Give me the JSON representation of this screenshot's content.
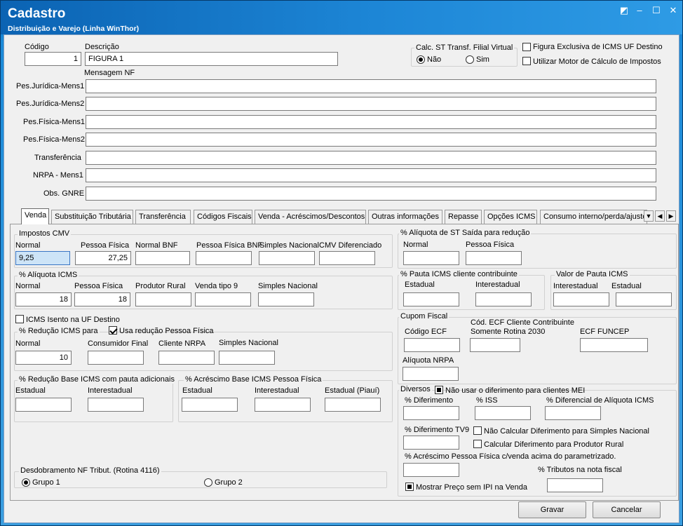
{
  "window": {
    "title": "Cadastro",
    "subtitle": "Distribuição e Varejo (Linha WinThor)",
    "btn_restore": "◩",
    "btn_min": "–",
    "btn_max": "☐",
    "btn_close": "✕"
  },
  "header": {
    "codigo_label": "Código",
    "codigo_value": "1",
    "descricao_label": "Descrição",
    "descricao_value": "FIGURA 1",
    "mensagem_nf_label": "Mensagem NF",
    "calc_st_label": "Calc. ST Transf. Filial Virtual",
    "radio_nao": "Não",
    "radio_sim": "Sim",
    "fig_exclusiva_label": "Figura Exclusiva de ICMS UF Destino",
    "motor_calc_label": "Utilizar Motor de Cálculo de Impostos"
  },
  "messages": [
    {
      "label": "Pes.Jurídica-Mens1"
    },
    {
      "label": "Pes.Jurídica-Mens2"
    },
    {
      "label": "Pes.Física-Mens1"
    },
    {
      "label": "Pes.Física-Mens2"
    },
    {
      "label": "Transferência"
    },
    {
      "label": "NRPA - Mens1"
    },
    {
      "label": "Obs. GNRE"
    }
  ],
  "tabs": [
    "Venda",
    "Substituição Tributária",
    "Transferência",
    "Códigos Fiscais",
    "Venda - Acréscimos/Descontos",
    "Outras informações",
    "Repasse",
    "Opções ICMS",
    "Consumo interno/perda/ajuste"
  ],
  "impostos_cmv": {
    "title": "Impostos CMV",
    "normal": "Normal",
    "normal_value": "9,25",
    "pf": "Pessoa Física",
    "pf_value": "27,25",
    "normal_bnf": "Normal BNF",
    "pf_bnf": "Pessoa Física BNF",
    "simples": "Simples Nacional",
    "cmv_dif": "CMV Diferenciado"
  },
  "aliq_icms": {
    "title": "% Alíquota ICMS",
    "normal": "Normal",
    "normal_value": "18",
    "pf": "Pessoa Física",
    "pf_value": "18",
    "prod_rural": "Produtor Rural",
    "venda_tipo9": "Venda tipo 9",
    "simples": "Simples Nacional"
  },
  "icms_isento": "ICMS Isento na UF Destino",
  "reducao_icms": {
    "title": "% Redução ICMS para",
    "usa_reducao": "Usa redução Pessoa Física",
    "normal": "Normal",
    "normal_value": "10",
    "consumidor": "Consumidor Final",
    "cliente_nrpa": "Cliente NRPA",
    "simples": "Simples Nacional"
  },
  "reducao_base": {
    "title": "% Redução Base ICMS com pauta adicionais",
    "estadual": "Estadual",
    "interestadual": "Interestadual"
  },
  "acrescimo_base": {
    "title": "% Acréscimo Base ICMS Pessoa Física",
    "estadual": "Estadual",
    "interestadual": "Interestadual",
    "estadual_piaui": "Estadual (Piauí)"
  },
  "desdobramento": {
    "title": "Desdobramento NF Tribut. (Rotina 4116)",
    "grupo1": "Grupo 1",
    "grupo2": "Grupo 2"
  },
  "aliq_st": {
    "title": "% Alíquota de ST Saída para redução",
    "normal": "Normal",
    "pf": "Pessoa Física"
  },
  "pauta_icms": {
    "title": "% Pauta ICMS cliente contribuinte",
    "estadual": "Estadual",
    "interestadual": "Interestadual"
  },
  "valor_pauta": {
    "title": "Valor de Pauta ICMS",
    "interestadual": "Interestadual",
    "estadual": "Estadual"
  },
  "cupom": {
    "title": "Cupom Fiscal",
    "codigo_ecf": "Código ECF",
    "cod_ecf_cliente": "Cód. ECF Cliente Contribuinte",
    "somente_rotina": "Somente Rotina 2030",
    "ecf_funcep": "ECF FUNCEP",
    "aliq_nrpa": "Alíquota NRPA"
  },
  "diversos": {
    "title": "Diversos",
    "nao_usar": "Não usar o diferimento para clientes MEI",
    "diferimento": "% Diferimento",
    "iss": "% ISS",
    "dif_aliq": "% Diferencial de Alíquota ICMS",
    "dif_tv9": "% Diferimento TV9",
    "nao_calc": "Não Calcular Diferimento para Simples Nacional",
    "calc_prod": "Calcular Diferimento para Produtor Rural",
    "acresc_pf": "% Acréscimo Pessoa Física c/venda acima do parametrizado.",
    "tributos": "% Tributos na nota fiscal",
    "mostrar_preco": "Mostrar Preço sem IPI na Venda"
  },
  "buttons": {
    "gravar": "Gravar",
    "cancelar": "Cancelar"
  }
}
